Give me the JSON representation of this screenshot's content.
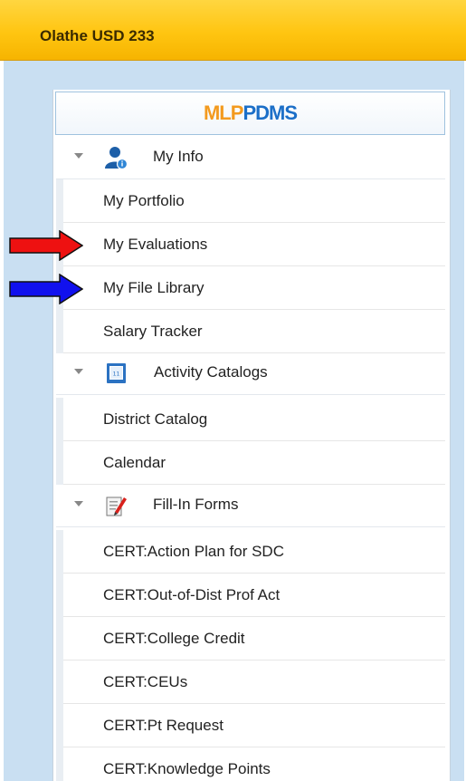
{
  "app": {
    "org_title": "Olathe USD 233"
  },
  "logo": {
    "part1": "MLP",
    "part2": "PDMS"
  },
  "nav": {
    "my_info": {
      "label": "My Info",
      "items": [
        "My Portfolio",
        "My Evaluations",
        "My File Library",
        "Salary Tracker"
      ]
    },
    "activity_catalogs": {
      "label": "Activity Catalogs",
      "items": [
        "District Catalog",
        "Calendar"
      ]
    },
    "fill_in_forms": {
      "label": "Fill-In Forms",
      "items": [
        "CERT:Action Plan for SDC",
        "CERT:Out-of-Dist Prof Act",
        "CERT:College Credit",
        "CERT:CEUs",
        "CERT:Pt Request",
        "CERT:Knowledge Points"
      ]
    }
  },
  "annotations": {
    "red_arrow_color": "#ee1111",
    "blue_arrow_color": "#1111ee"
  },
  "icons": {
    "my_info": "user-icon",
    "activity_catalogs": "catalog-icon",
    "fill_in_forms": "form-edit-icon",
    "section_toggle": "chevron-down-icon"
  }
}
